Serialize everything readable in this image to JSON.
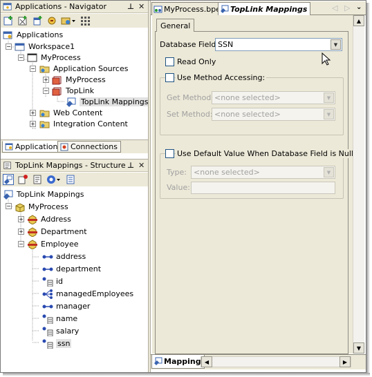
{
  "navigator": {
    "title": "Applications - Navigator",
    "pin": "⊥",
    "close": "✕",
    "tree": [
      {
        "label": "Applications",
        "icon": "applications-icon"
      },
      {
        "label": "Workspace1",
        "icon": "workspace-icon"
      },
      {
        "label": "MyProcess",
        "icon": "project-icon"
      },
      {
        "label": "Application Sources",
        "icon": "folder-icon"
      },
      {
        "label": "MyProcess",
        "icon": "package-icon"
      },
      {
        "label": "TopLink",
        "icon": "package-icon"
      },
      {
        "label": "TopLink Mappings",
        "icon": "toplink-mappings-icon"
      },
      {
        "label": "Web Content",
        "icon": "folder-icon"
      },
      {
        "label": "Integration Content",
        "icon": "folder-icon"
      }
    ],
    "tabs": [
      "Applications",
      "Connections"
    ]
  },
  "structure": {
    "title": "TopLink Mappings - Structure",
    "pin": "⊥",
    "close": "✕",
    "tree": [
      {
        "label": "TopLink Mappings",
        "icon": "toplink-mappings-icon"
      },
      {
        "label": "MyProcess",
        "icon": "project-cube-icon"
      },
      {
        "label": "Address",
        "icon": "descriptor-icon"
      },
      {
        "label": "Department",
        "icon": "descriptor-icon"
      },
      {
        "label": "Employee",
        "icon": "descriptor-icon"
      },
      {
        "label": "address",
        "icon": "one-to-one-mapping-icon"
      },
      {
        "label": "department",
        "icon": "one-to-one-mapping-icon"
      },
      {
        "label": "id",
        "icon": "direct-mapping-icon"
      },
      {
        "label": "managedEmployees",
        "icon": "one-to-many-mapping-icon"
      },
      {
        "label": "manager",
        "icon": "one-to-one-mapping-icon"
      },
      {
        "label": "name",
        "icon": "direct-mapping-icon"
      },
      {
        "label": "salary",
        "icon": "direct-mapping-icon"
      },
      {
        "label": "ssn",
        "icon": "direct-mapping-icon"
      }
    ]
  },
  "editor": {
    "tabs": [
      "MyProcess.bpel",
      "TopLink Mappings"
    ],
    "active_tab": "TopLink Mappings",
    "subtab": "General",
    "database_field_label": "Database Field:",
    "database_field_value": "SSN",
    "read_only_label": "Read Only",
    "use_method_accessing_label": "Use Method Accessing:",
    "get_method_label": "Get Method:",
    "get_method_value": "<none selected>",
    "set_method_label": "Set Method:",
    "set_method_value": "<none selected>",
    "use_default_value_label": "Use Default Value When Database Field is Null:",
    "type_label": "Type:",
    "type_value": "<none selected>",
    "value_label": "Value:",
    "value_value": "",
    "bottom_tab": "Mapping"
  }
}
